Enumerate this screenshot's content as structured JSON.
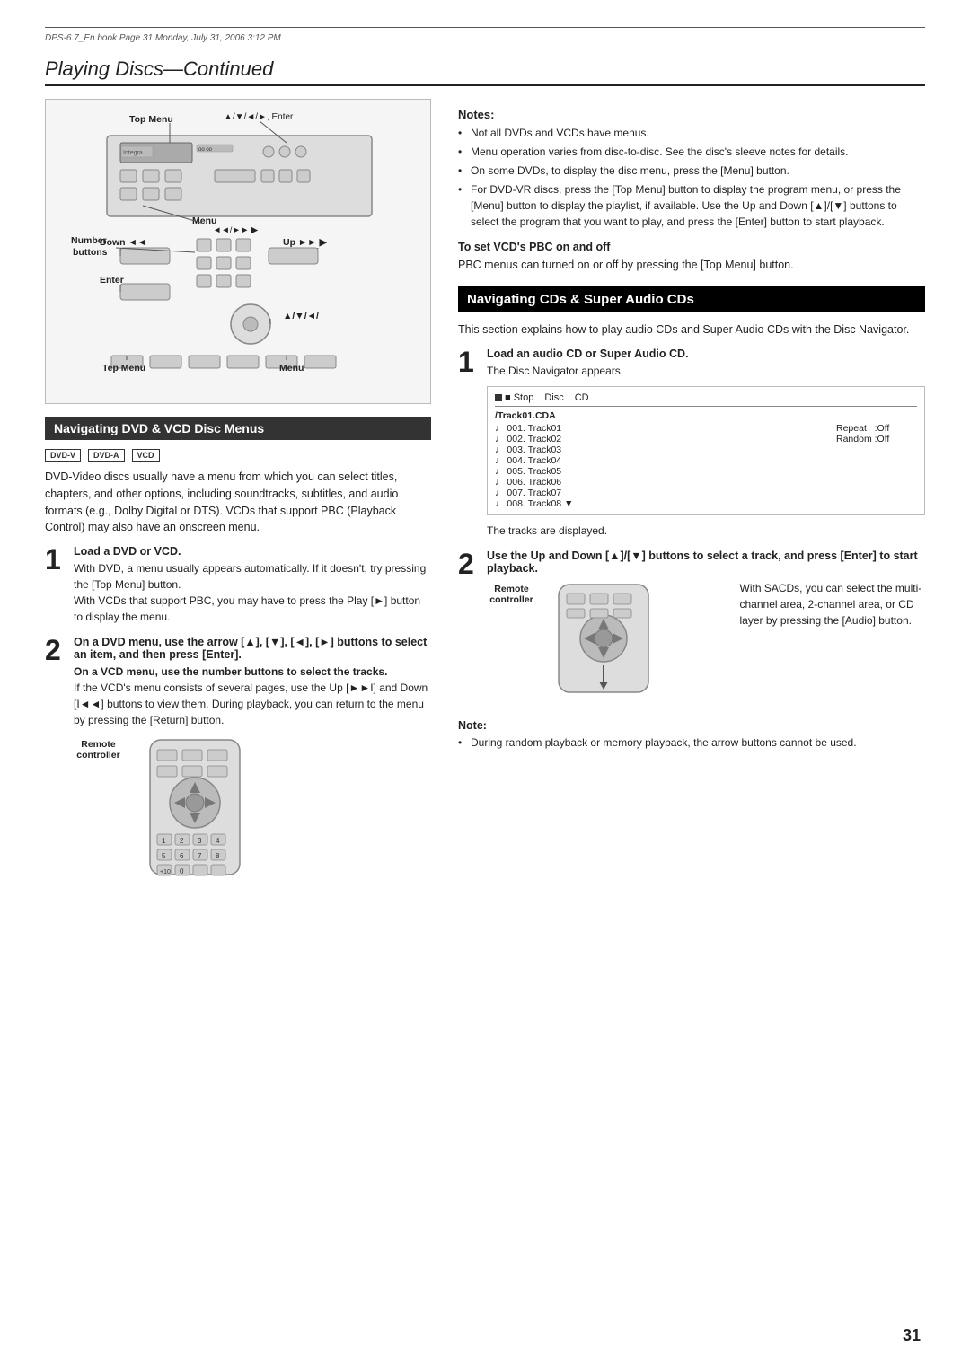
{
  "page": {
    "file_info": "DPS-6.7_En.book  Page 31  Monday, July 31, 2006  3:12 PM",
    "page_number": "31",
    "title": "Playing Discs",
    "title_continued": "—Continued"
  },
  "diagram": {
    "labels": {
      "top_menu": "Top Menu",
      "top_menu_arrows": "▲/▼/◄/►, Enter",
      "menu": "Menu",
      "menu_arrows": "◄◄/►►",
      "number_buttons": "Number\nbuttons",
      "down": "Down ◄◄",
      "up": "Up ►►",
      "enter": "Enter",
      "arrows": "▲/▼/◄/",
      "tep_menu": "Tep Menu",
      "menu2": "Menu"
    }
  },
  "section1": {
    "header": "Navigating DVD & VCD Disc Menus",
    "disc_types": [
      "DVD-V",
      "DVD-A",
      "VCD"
    ],
    "intro": "DVD-Video discs usually have a menu from which you can select titles, chapters, and other options, including soundtracks, subtitles, and audio formats (e.g., Dolby Digital or DTS). VCDs that support PBC (Playback Control) may also have an onscreen menu.",
    "step1": {
      "number": "1",
      "title": "Load a DVD or VCD.",
      "body": "With DVD, a menu usually appears automatically. If it doesn't, try pressing the [Top Menu] button.\nWith VCDs that support PBC, you may have to press the Play [►] button to display the menu."
    },
    "step2": {
      "number": "2",
      "title": "On a DVD menu, use the arrow [▲], [▼], [◄], [►] buttons to select an item, and then press [Enter].",
      "body2": "On a VCD menu, use the number buttons to select the tracks.",
      "body3": "If the VCD's menu consists of several pages, use the Up [►►I] and Down [I◄◄] buttons to view them. During playback, you can return to the menu by pressing the [Return] button."
    },
    "remote_label": "Remote\ncontroller"
  },
  "notes_right": {
    "title": "Notes:",
    "items": [
      "Not all DVDs and VCDs have menus.",
      "Menu operation varies from disc-to-disc. See the disc's sleeve notes for details.",
      "On some DVDs, to display the disc menu, press the [Menu] button.",
      "For DVD-VR discs, press the [Top Menu] button to display the program menu, or press the [Menu] button to display the playlist, if available. Use the Up and Down [▲]/[▼] buttons to select the program that you want to play, and press the [Enter] button to start playback."
    ]
  },
  "vcd_section": {
    "title": "To set VCD's PBC on and off",
    "body": "PBC menus can turned on or off by pressing the [Top Menu] button."
  },
  "section2": {
    "header": "Navigating CDs & Super Audio CDs",
    "intro": "This section explains how to play audio CDs and Super Audio CDs with the Disc Navigator.",
    "step1": {
      "number": "1",
      "title": "Load an audio CD or Super Audio CD.",
      "body": "The Disc Navigator appears.",
      "nav_box": {
        "stop_label": "■ Stop",
        "disc_label": "Disc",
        "cd_label": "CD",
        "folder": "/Track01.CDA",
        "tracks": [
          "♩ 001. Track01",
          "♩ 002. Track02",
          "♩ 003. Track03",
          "♩ 004. Track04",
          "♩ 005. Track05",
          "♩ 006. Track06",
          "♩ 007. Track07",
          "♩ 008. Track08"
        ],
        "repeat_label": "Repeat",
        "repeat_value": ":Off",
        "random_label": "Random",
        "random_value": ":Off"
      },
      "footer": "The tracks are displayed."
    },
    "step2": {
      "number": "2",
      "title": "Use the Up and Down [▲]/[▼] buttons to select a track, and press [Enter] to start playback.",
      "body": "With SACDs, you can select the multi-channel area, 2-channel area, or CD layer by pressing the [Audio] button.",
      "remote_label": "Remote\ncontroller"
    },
    "bottom_note": {
      "title": "Note:",
      "items": [
        "During random playback or memory playback, the arrow buttons cannot be used."
      ]
    }
  }
}
